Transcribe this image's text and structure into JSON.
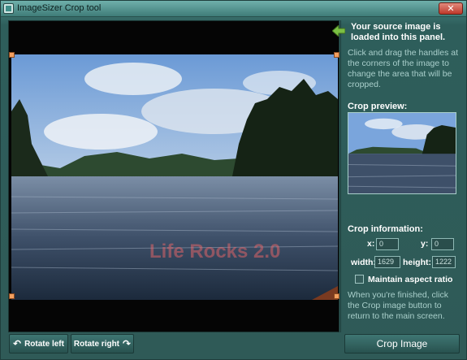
{
  "window": {
    "title": "ImageSizer Crop tool",
    "close_glyph": "✕"
  },
  "image_panel": {
    "watermark_text": "Life Rocks 2.0"
  },
  "buttons": {
    "rotate_left": "Rotate left",
    "rotate_left_icon": "rotate-left-icon",
    "rotate_right": "Rotate right",
    "rotate_right_icon": "rotate-right-icon",
    "crop_image": "Crop Image"
  },
  "sidebar": {
    "source_message": "Your source image is loaded into this panel.",
    "help_text": "Click and drag the handles at the corners of the image to change the area that will be cropped.",
    "preview_title": "Crop preview:",
    "crop_info_title": "Crop information:",
    "x_label": "x:",
    "x_value": "0",
    "y_label": "y:",
    "y_value": "0",
    "width_label": "width:",
    "width_value": "1629",
    "height_label": "height:",
    "height_value": "1222",
    "maintain_aspect_label": "Maintain aspect ratio",
    "maintain_aspect_checked": false,
    "finish_text": "When you're finished, click the Crop image button to return to the main screen."
  },
  "colors": {
    "window_bg": "#2f5a57",
    "accent_green": "#7bc043",
    "handle_orange": "#f3a060"
  }
}
